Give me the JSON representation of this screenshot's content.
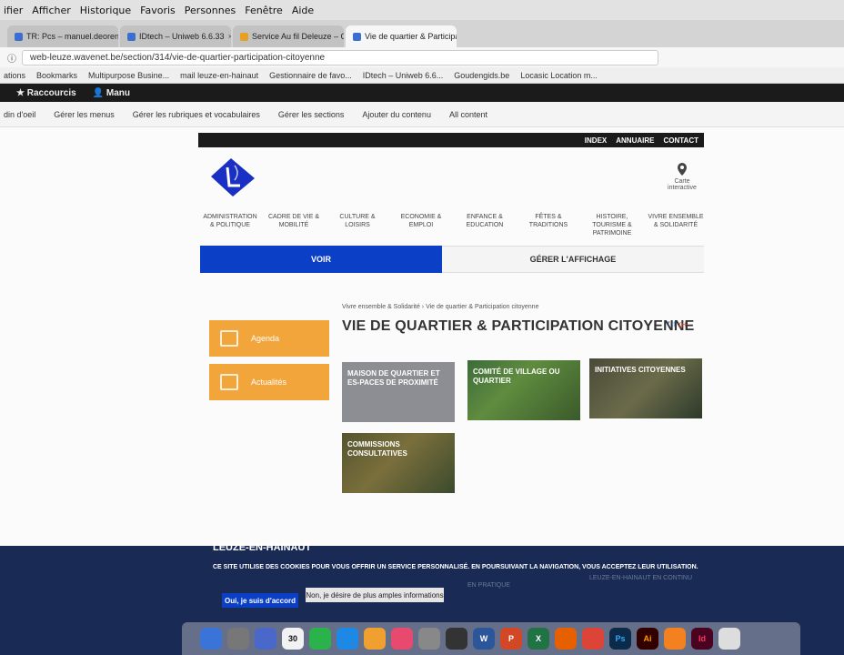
{
  "menubar": [
    "ifier",
    "Afficher",
    "Historique",
    "Favoris",
    "Personnes",
    "Fenêtre",
    "Aide"
  ],
  "tabs": [
    {
      "title": "TR: Pcs – manuel.deoreno",
      "active": false
    },
    {
      "title": "IDtech – Uniweb 6.6.33",
      "active": false
    },
    {
      "title": "Service Au fil Deleuze – Outlo",
      "active": false
    },
    {
      "title": "Vie de quartier & Participatio",
      "active": true
    }
  ],
  "url": "web-leuze.wavenet.be/section/314/vie-de-quartier-participation-citoyenne",
  "bookmarks": [
    "ations",
    "Bookmarks",
    "Multipurpose Busine...",
    "mail leuze-en-hainaut",
    "Gestionnaire de favo...",
    "IDtech – Uniweb 6.6...",
    "Goudengids.be",
    "Locasic Location m..."
  ],
  "admin": {
    "shortcuts": "Raccourcis",
    "user": "Manu"
  },
  "admin_menu": [
    "din d'oeil",
    "Gérer les menus",
    "Gérer les rubriques et vocabulaires",
    "Gérer les sections",
    "Ajouter du contenu",
    "All content"
  ],
  "top_links": [
    "INDEX",
    "ANNUAIRE",
    "CONTACT"
  ],
  "map": {
    "line1": "Carte",
    "line2": "interactive"
  },
  "nav": [
    "ADMINISTRATION & POLITIQUE",
    "CADRE DE VIE & MOBILITÉ",
    "CULTURE & LOISIRS",
    "ECONOMIE & EMPLOI",
    "ENFANCE & EDUCATION",
    "FÊTES & TRADITIONS",
    "HISTOIRE, TOURISME & PATRIMOINE",
    "VIVRE ENSEMBLE & SOLIDARITÉ"
  ],
  "tabs_main": {
    "voir": "VOIR",
    "gerer": "GÉRER L'AFFICHAGE"
  },
  "breadcrumb": "Vivre ensemble & Solidarité  ›  Vie de quartier & Participation citoyenne",
  "page_title": "VIE DE QUARTIER & PARTICIPATION CITOYENNE",
  "side": [
    "Agenda",
    "Actualités"
  ],
  "cards": [
    "MAISON DE QUARTIER ET ES-PACES DE PROXIMITÉ",
    "COMITÉ DE VILLAGE OU QUARTIER",
    "INITIATIVES CITOYENNES",
    "COMMISSIONS CONSULTATIVES"
  ],
  "footer": {
    "title": "LEUZE-EN-HAINAUT",
    "cookie": "CE SITE UTILISE DES COOKIES POUR VOUS OFFRIR UN SERVICE PERSONNALISÉ. EN POURSUIVANT LA NAVIGATION, VOUS ACCEPTEZ LEUR UTILISATION.",
    "ok": "Oui, je suis d'accord",
    "more": "Non, je désire de plus amples informations",
    "col1": "EN PRATIQUE",
    "col2": "LEUZE-EN-HAINAUT EN CONTINU"
  },
  "dock_calendar": "30",
  "colors": {
    "blue": "#0b3fc6",
    "orange": "#f2a53a",
    "footer": "#192b55"
  }
}
